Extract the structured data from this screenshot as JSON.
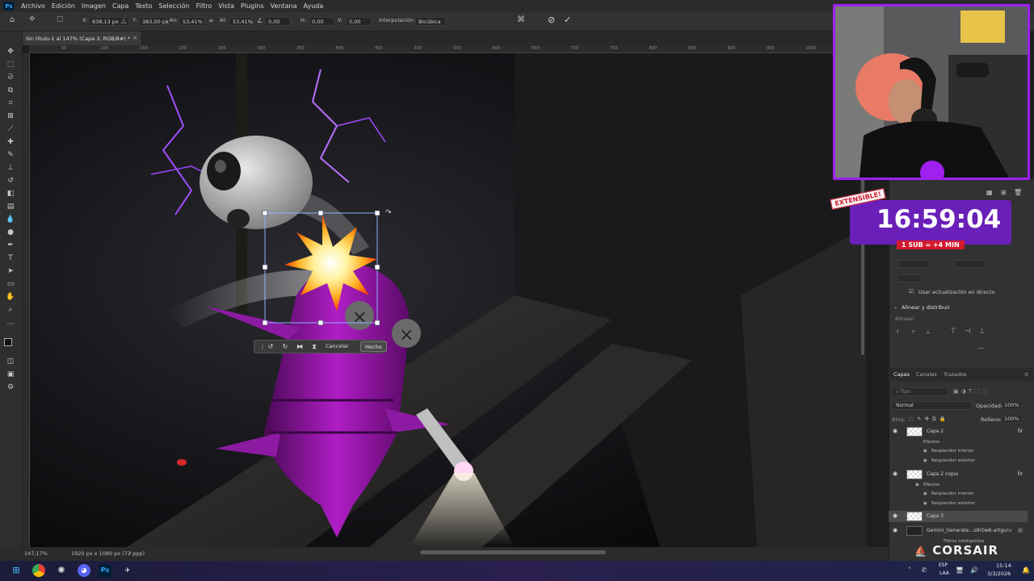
{
  "app": {
    "name": "Photoshop",
    "logo": "Ps"
  },
  "menu": [
    "Archivo",
    "Edición",
    "Imagen",
    "Capa",
    "Texto",
    "Selección",
    "Filtro",
    "Vista",
    "Plugins",
    "Ventana",
    "Ayuda"
  ],
  "options": {
    "x_label": "X:",
    "x_value": "838,13 px",
    "y_label": "Y:",
    "y_value": "383,00 px",
    "w_label": "An:",
    "w_value": "53,41%",
    "h_label": "Al:",
    "h_value": "53,41%",
    "angle_value": "0,00",
    "hskew_label": "H:",
    "hskew_value": "0,00",
    "vskew_label": "V:",
    "vskew_value": "0,00",
    "interp_label": "Interpolación:",
    "interp_value": "Bicúbica"
  },
  "document": {
    "tab_title": "Sin título-1 al 147% (Capa 3, RGB/8#) *"
  },
  "ruler_labels": [
    "50",
    "100",
    "150",
    "200",
    "250",
    "300",
    "350",
    "400",
    "450",
    "500",
    "550",
    "600",
    "650",
    "700",
    "750",
    "800",
    "850",
    "900",
    "950",
    "1000",
    "1050"
  ],
  "status": {
    "zoom": "147,17%",
    "size": "1920 px x 1080 px (72 ppp)"
  },
  "transform_bar": {
    "cancel": "Cancelar",
    "done": "Hecho"
  },
  "properties": {
    "live_update_label": "Usar actualización en directo",
    "align_header": "Alinear y distribuir",
    "align_label": "Alinear:",
    "more": "..."
  },
  "layers_panel": {
    "tabs": [
      "Capas",
      "Canales",
      "Trazados"
    ],
    "search_placeholder": "Tipo",
    "blend_mode": "Normal",
    "opacity_label": "Opacidad:",
    "opacity_value": "100%",
    "lock_label": "Bloq:",
    "fill_label": "Relleno:",
    "fill_value": "100%",
    "layers": [
      {
        "name": "Capa 2",
        "fx": "fx",
        "effects_label": "Efectos",
        "effects": [
          "Resplandor interior",
          "Resplandor exterior"
        ]
      },
      {
        "name": "Capa 2 copia",
        "fx": "fx",
        "effects_label": "Efectos",
        "effects": [
          "Resplandor interior",
          "Resplandor exterior"
        ]
      },
      {
        "name": "Capa 3"
      },
      {
        "name": "Gemini_Generate...o9r0w6-artguru",
        "sub": "Filtros inteligentes"
      }
    ]
  },
  "overlay": {
    "extensible": "EXTENSIBLE!",
    "timer": "16:59:04",
    "sub_info": "1 SUB = +4 MIN",
    "brand": "CORSAIR"
  },
  "taskbar": {
    "lang": "ESP",
    "region": "LAA",
    "time": "15:14",
    "date": "3/3/2026"
  },
  "colors": {
    "accent_purple": "#a020f0",
    "timer_bg": "#6a1fb8",
    "sub_red": "#d41a2e"
  }
}
